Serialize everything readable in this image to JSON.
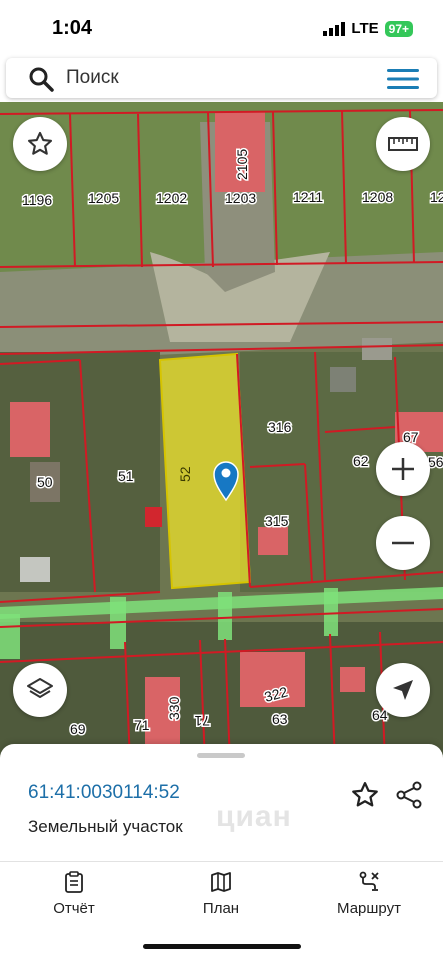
{
  "status_bar": {
    "time": "1:04",
    "network": "LTE",
    "battery": "97+"
  },
  "search": {
    "placeholder": "Поиск"
  },
  "map": {
    "parcel_labels": {
      "p1196": "1196",
      "p1205": "1205",
      "p1202": "1202",
      "p1203": "1203",
      "p1211": "1211",
      "p1208": "1208",
      "p12": "12",
      "p2105": "2105",
      "p316": "316",
      "p62": "62",
      "p67": "67",
      "p56": "56",
      "p50": "50",
      "p51": "51",
      "p52": "52",
      "p315": "315",
      "p330": "330",
      "p322": "322",
      "p69": "69",
      "p71": "71",
      "p71r": "71",
      "p63": "63",
      "p64": "64"
    },
    "selected_parcel_color": "#f3e62a",
    "parcel_line_color": "#d11a24",
    "road_color": "#7fe27a"
  },
  "sheet": {
    "cadastral_number": "61:41:0030114:52",
    "parcel_type": "Земельный участок",
    "watermark": "циан"
  },
  "tabs": [
    {
      "label": "Отчёт",
      "icon": "report-icon"
    },
    {
      "label": "План",
      "icon": "map-plan-icon"
    },
    {
      "label": "Маршрут",
      "icon": "route-icon"
    }
  ]
}
